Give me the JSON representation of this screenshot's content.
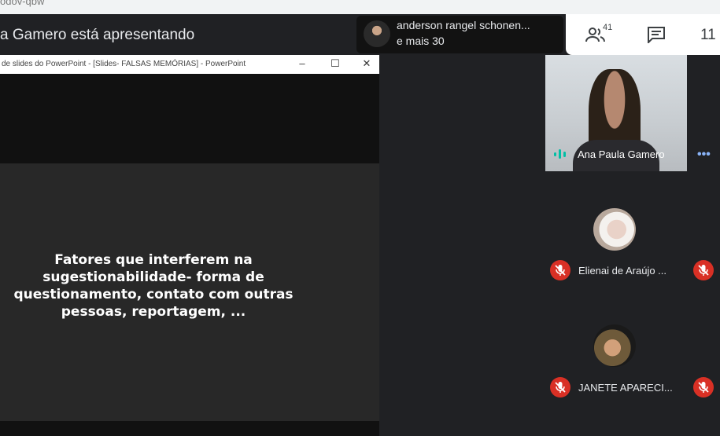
{
  "browser": {
    "url_fragment": "odov-qbw"
  },
  "meet": {
    "presenting_text": "a Gamero está apresentando",
    "presenter_pill": {
      "name": "anderson rangel schonen...",
      "more": "e mais 30"
    },
    "toolbar": {
      "people_count": "41",
      "time": "11"
    }
  },
  "powerpoint": {
    "title": "de slides do PowerPoint - [Slides- FALSAS MEMÓRIAS] - PowerPoint",
    "controls": {
      "minimize": "–",
      "maximize": "☐",
      "close": "✕"
    },
    "slide_lines": [
      "Fatores que interferem na",
      "sugestionabilidade- forma de",
      "questionamento, contato com outras",
      "pessoas, reportagem, ..."
    ]
  },
  "participants": [
    {
      "name": "Ana Paula Gamero",
      "more": "•••"
    },
    {
      "name": "Elienai de Araújo ..."
    },
    {
      "name": "JANETE APARECI..."
    }
  ],
  "colors": {
    "muted_mic": "#d93025",
    "speaking": "#00bfa5",
    "accent": "#8ab4f8"
  }
}
